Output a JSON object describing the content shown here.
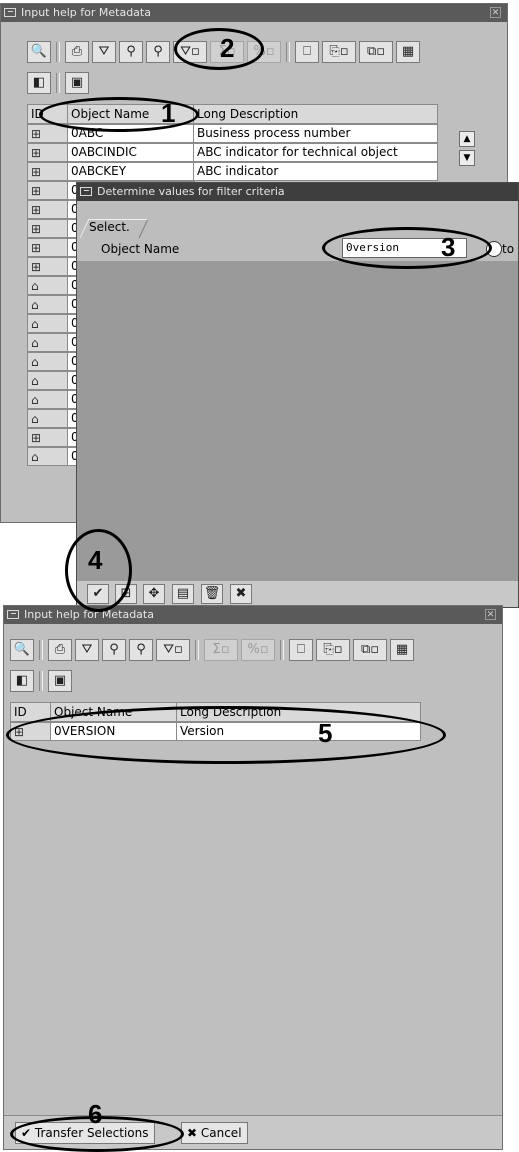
{
  "top_dialog": {
    "title": "Input help for Metadata",
    "columns": {
      "id": "ID",
      "name": "Object Name",
      "desc": "Long Description"
    },
    "rows": [
      {
        "name": "0ABC",
        "desc": "Business process number"
      },
      {
        "name": "0ABCINDIC",
        "desc": "ABC indicator for technical object"
      },
      {
        "name": "0ABCKEY",
        "desc": "ABC indicator"
      },
      {
        "name": "0"
      },
      {
        "name": "0"
      },
      {
        "name": "0"
      },
      {
        "name": "0"
      },
      {
        "name": "0"
      },
      {
        "name": "0"
      },
      {
        "name": "0"
      },
      {
        "name": "0"
      },
      {
        "name": "0"
      },
      {
        "name": "0"
      },
      {
        "name": "0"
      },
      {
        "name": "0"
      },
      {
        "name": "0"
      },
      {
        "name": "0"
      },
      {
        "name": "0"
      }
    ]
  },
  "filter_dialog": {
    "title": "Determine values for filter criteria",
    "tab": "Select.",
    "field_label": "Object Name",
    "field_value": "0version",
    "to_label": "to"
  },
  "bottom_dialog": {
    "title": "Input help for Metadata",
    "columns": {
      "id": "ID",
      "name": "Object Name",
      "desc": "Long Description"
    },
    "rows": [
      {
        "name": "0VERSION",
        "desc": "Version"
      }
    ],
    "transfer_label": "Transfer Selections",
    "cancel_label": "Cancel"
  },
  "annotations": [
    "1",
    "2",
    "3",
    "4",
    "5",
    "6"
  ]
}
